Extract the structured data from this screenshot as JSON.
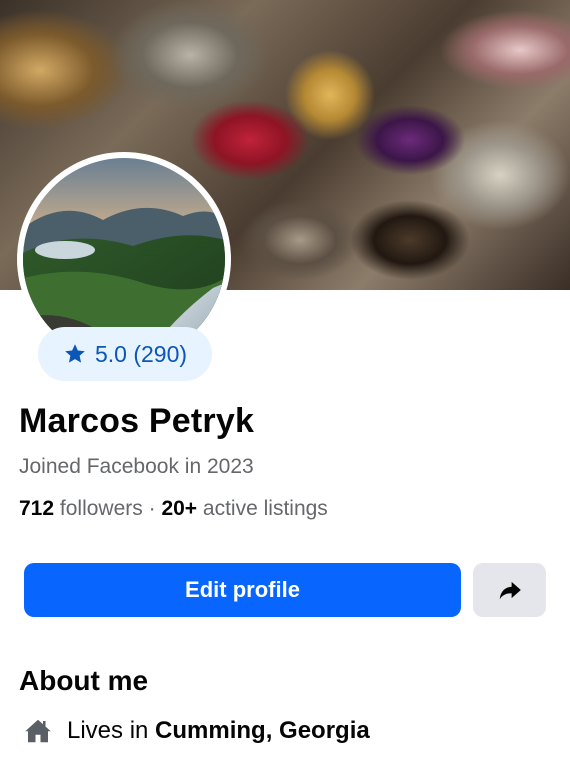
{
  "profile": {
    "name": "Marcos Petryk",
    "joined": "Joined Facebook in 2023",
    "rating": "5.0 (290)",
    "followers_count": "712",
    "followers_label": "followers",
    "separator": "·",
    "listings_count": "20+",
    "listings_label": "active listings"
  },
  "actions": {
    "edit_label": "Edit profile",
    "share_icon": "share-arrow-icon"
  },
  "about": {
    "title": "About me",
    "lives_prefix": "Lives in",
    "location": "Cumming, Georgia",
    "lives_icon": "home-icon"
  },
  "colors": {
    "primary_button": "#0866ff",
    "badge_bg": "#e7f3ff",
    "badge_text": "#0a57b8",
    "secondary_button": "#e4e6eb",
    "muted_text": "#65676b"
  }
}
